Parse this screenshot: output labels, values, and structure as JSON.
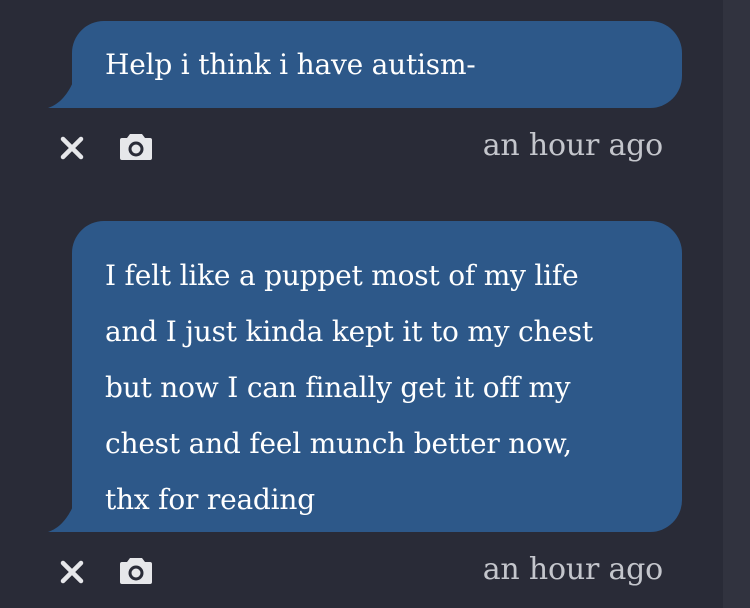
{
  "messages": [
    {
      "text": "Help i think i have autism-",
      "timestamp": "an hour ago",
      "close_icon": "close-icon",
      "camera_icon": "camera-icon"
    },
    {
      "text": "I felt like a puppet most of my life\nand I just kinda kept it to my chest\nbut now I can finally get it off my\nchest and feel munch better now,\nthx for reading",
      "timestamp": "an hour ago",
      "close_icon": "close-icon",
      "camera_icon": "camera-icon"
    }
  ],
  "colors": {
    "background": "#292b37",
    "bubble": "#2d5889",
    "bubble_text": "#ffffff",
    "timestamp": "#c4c6cc",
    "icon": "#e6e7ea"
  }
}
